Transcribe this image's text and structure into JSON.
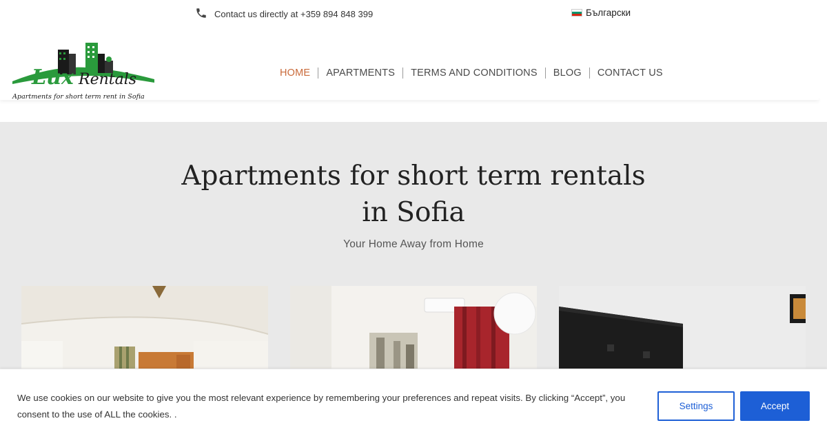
{
  "topbar": {
    "phone_text": "Contact us directly at +359 894 848 399",
    "phone_icon": "phone-icon",
    "language_label": "Български",
    "flag_colors": [
      "#ffffff",
      "#00966e",
      "#d62612"
    ]
  },
  "logo": {
    "main_text_a": "Lux",
    "main_text_b": "Rentals",
    "tagline": "Apartments for short term rent in Sofia",
    "brand_green": "#2a9a3c"
  },
  "nav": {
    "items": [
      {
        "label": "HOME",
        "active": true
      },
      {
        "label": "APARTMENTS",
        "active": false
      },
      {
        "label": "TERMS AND CONDITIONS",
        "active": false
      },
      {
        "label": "BLOG",
        "active": false
      },
      {
        "label": "CONTACT US",
        "active": false
      }
    ],
    "active_color": "#c96a3a"
  },
  "hero": {
    "title_line1": "Apartments for short term rentals",
    "title_line2": "in Sofia",
    "subtitle": "Your Home Away from Home"
  },
  "cookie": {
    "text": "We use cookies on our website to give you the most relevant experience by remembering your preferences and repeat visits. By clicking “Accept”, you consent to the use of ALL the cookies. .",
    "settings_label": "Settings",
    "accept_label": "Accept",
    "accent_color": "#1d5fd6"
  }
}
